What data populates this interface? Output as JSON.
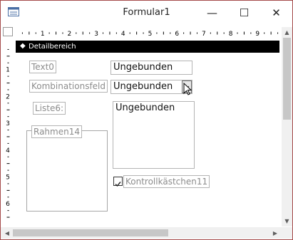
{
  "window": {
    "title": "Formular1",
    "minimize_glyph": "—",
    "maximize_glyph": "☐",
    "close_glyph": "✕"
  },
  "ruler": {
    "horizontal_marks": [
      "1",
      "2",
      "3",
      "4",
      "5",
      "6",
      "7",
      "8",
      "9"
    ],
    "vertical_marks": [
      "1",
      "2",
      "3",
      "4",
      "5",
      "6"
    ]
  },
  "section": {
    "label": "Detailbereich",
    "arrow_glyph": "◆"
  },
  "controls": {
    "text0_label": "Text0",
    "text0_value": "Ungebunden",
    "combo_label": "Kombinationsfeld",
    "combo_value": "Ungebunden",
    "list_label": "Liste6:",
    "list_value": "Ungebunden",
    "frame_label": "Rahmen14",
    "checkbox_label": "Kontrollkästchen11"
  },
  "scrollbars": {
    "up_glyph": "▲",
    "down_glyph": "▼",
    "left_glyph": "◀",
    "right_glyph": "▶"
  }
}
